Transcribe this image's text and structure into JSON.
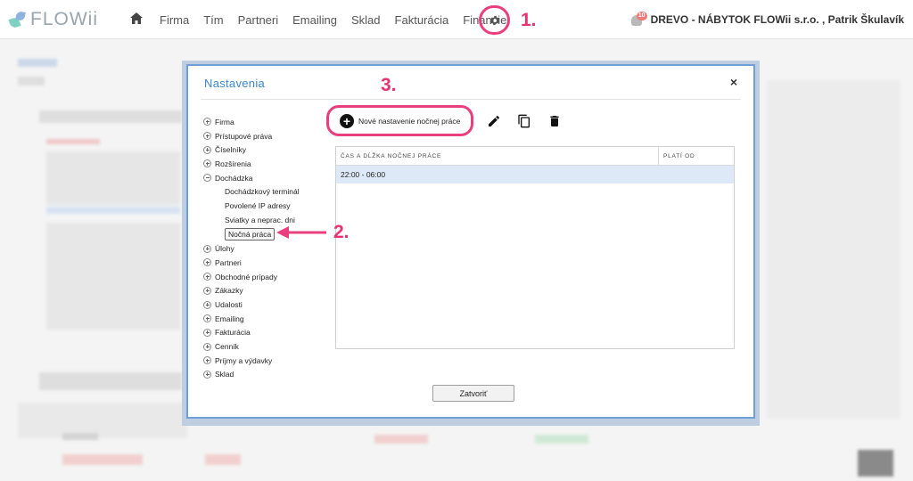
{
  "app": {
    "logo_text": "FLOWii"
  },
  "nav": {
    "items": [
      "Firma",
      "Tím",
      "Partneri",
      "Emailing",
      "Sklad",
      "Fakturácia",
      "Financie"
    ]
  },
  "user": {
    "badge": "10",
    "company": "DREVO - NÁBYTOK FLOWii s.r.o. , Patrik Škulavík"
  },
  "annotations": {
    "a1": "1.",
    "a2": "2.",
    "a3": "3."
  },
  "modal": {
    "title": "Nastavenia",
    "close": "×",
    "tree": {
      "top": [
        {
          "label": "Firma",
          "state": "collapsed"
        },
        {
          "label": "Prístupové práva",
          "state": "collapsed"
        },
        {
          "label": "Číselníky",
          "state": "collapsed"
        },
        {
          "label": "Rozšírenia",
          "state": "collapsed"
        },
        {
          "label": "Dochádzka",
          "state": "expanded"
        }
      ],
      "children": [
        "Dochádzkový terminál",
        "Povolené IP adresy",
        "Sviatky a neprac. dni",
        "Nočná práca"
      ],
      "bottom": [
        "Úlohy",
        "Partneri",
        "Obchodné prípady",
        "Zákazky",
        "Udalosti",
        "Emailing",
        "Fakturácia",
        "Cenník",
        "Príjmy a výdavky",
        "Sklad"
      ]
    },
    "toolbar": {
      "new_label": "Nové nastavenie nočnej práce"
    },
    "table": {
      "columns": [
        "ČAS A DĹŽKA NOČNEJ PRÁCE",
        "PLATÍ OD"
      ],
      "rows": [
        [
          "22:00 - 06:00",
          ""
        ]
      ]
    },
    "close_button": "Zatvoriť"
  },
  "colors": {
    "accent": "#ea3f7e",
    "title_blue": "#3a87c9",
    "selected_row": "#dde9f6"
  }
}
